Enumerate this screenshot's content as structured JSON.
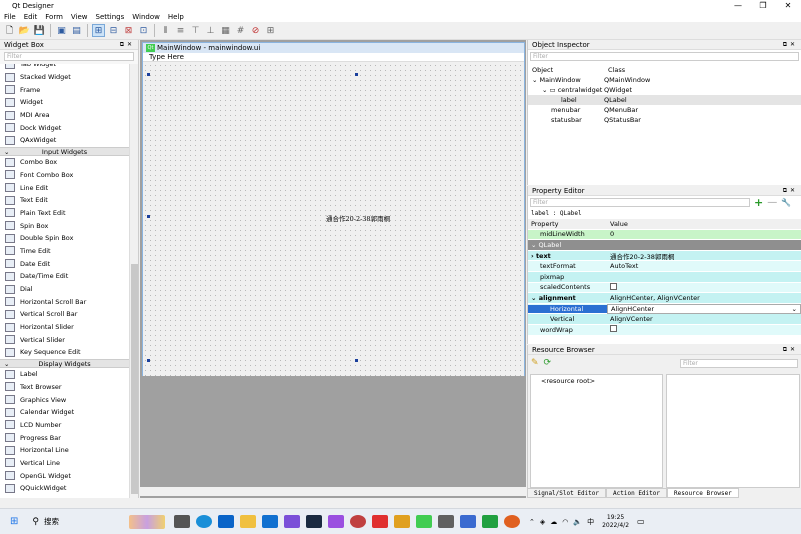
{
  "window": {
    "title": "Qt Designer",
    "minimize": "—",
    "maximize": "❐",
    "close": "✕"
  },
  "menu": [
    "File",
    "Edit",
    "Form",
    "View",
    "Settings",
    "Window",
    "Help"
  ],
  "widget_box": {
    "title": "Widget Box",
    "filter_placeholder": "Filter",
    "items_top": [
      {
        "label": "Tab Widget",
        "icon": "tab-widget-icon"
      },
      {
        "label": "Stacked Widget",
        "icon": "stacked-widget-icon"
      },
      {
        "label": "Frame",
        "icon": "frame-icon"
      },
      {
        "label": "Widget",
        "icon": "widget-icon"
      },
      {
        "label": "MDI Area",
        "icon": "mdi-area-icon"
      },
      {
        "label": "Dock Widget",
        "icon": "dock-widget-icon"
      },
      {
        "label": "QAxWidget",
        "icon": "qaxwidget-icon"
      }
    ],
    "category_input": "Input Widgets",
    "items_input": [
      {
        "label": "Combo Box",
        "icon": "combo-box-icon"
      },
      {
        "label": "Font Combo Box",
        "icon": "font-combo-box-icon"
      },
      {
        "label": "Line Edit",
        "icon": "line-edit-icon"
      },
      {
        "label": "Text Edit",
        "icon": "text-edit-icon"
      },
      {
        "label": "Plain Text Edit",
        "icon": "plain-text-edit-icon"
      },
      {
        "label": "Spin Box",
        "icon": "spin-box-icon"
      },
      {
        "label": "Double Spin Box",
        "icon": "double-spin-box-icon"
      },
      {
        "label": "Time Edit",
        "icon": "time-edit-icon"
      },
      {
        "label": "Date Edit",
        "icon": "date-edit-icon"
      },
      {
        "label": "Date/Time Edit",
        "icon": "datetime-edit-icon"
      },
      {
        "label": "Dial",
        "icon": "dial-icon"
      },
      {
        "label": "Horizontal Scroll Bar",
        "icon": "horizontal-scroll-bar-icon"
      },
      {
        "label": "Vertical Scroll Bar",
        "icon": "vertical-scroll-bar-icon"
      },
      {
        "label": "Horizontal Slider",
        "icon": "horizontal-slider-icon"
      },
      {
        "label": "Vertical Slider",
        "icon": "vertical-slider-icon"
      },
      {
        "label": "Key Sequence Edit",
        "icon": "key-sequence-edit-icon"
      }
    ],
    "category_display": "Display Widgets",
    "items_display": [
      {
        "label": "Label",
        "icon": "label-icon"
      },
      {
        "label": "Text Browser",
        "icon": "text-browser-icon"
      },
      {
        "label": "Graphics View",
        "icon": "graphics-view-icon"
      },
      {
        "label": "Calendar Widget",
        "icon": "calendar-widget-icon"
      },
      {
        "label": "LCD Number",
        "icon": "lcd-number-icon"
      },
      {
        "label": "Progress Bar",
        "icon": "progress-bar-icon"
      },
      {
        "label": "Horizontal Line",
        "icon": "horizontal-line-icon"
      },
      {
        "label": "Vertical Line",
        "icon": "vertical-line-icon"
      },
      {
        "label": "OpenGL Widget",
        "icon": "opengl-widget-icon"
      },
      {
        "label": "QQuickWidget",
        "icon": "qquickwidget-icon"
      }
    ]
  },
  "form": {
    "title": "MainWindow - mainwindow.ui",
    "menu_placeholder": "Type Here",
    "label_text": "通合作20-2-38郭雨桐"
  },
  "object_inspector": {
    "title": "Object Inspector",
    "filter_placeholder": "Filter",
    "col_object": "Object",
    "col_class": "Class",
    "rows": [
      {
        "object": "MainWindow",
        "class": "QMainWindow"
      },
      {
        "object": "centralwidget",
        "class": "QWidget"
      },
      {
        "object": "label",
        "class": "QLabel"
      },
      {
        "object": "menubar",
        "class": "QMenuBar"
      },
      {
        "object": "statusbar",
        "class": "QStatusBar"
      }
    ]
  },
  "property_editor": {
    "title": "Property Editor",
    "filter_placeholder": "Filter",
    "context": "label : QLabel",
    "col_property": "Property",
    "col_value": "Value",
    "midlinewidth": {
      "k": "midLineWidth",
      "v": "0"
    },
    "section": "QLabel",
    "text": {
      "k": "text",
      "v": "通合作20-2-38郭雨桐"
    },
    "textformat": {
      "k": "textFormat",
      "v": "AutoText"
    },
    "pixmap": {
      "k": "pixmap",
      "v": ""
    },
    "scaledcontents": {
      "k": "scaledContents",
      "v": ""
    },
    "alignment": {
      "k": "alignment",
      "v": "AlignHCenter, AlignVCenter"
    },
    "horizontal": {
      "k": "Horizontal",
      "v": "AlignHCenter"
    },
    "vertical": {
      "k": "Vertical",
      "v": "AlignVCenter"
    },
    "wordwrap": {
      "k": "wordWrap",
      "v": ""
    }
  },
  "resource_browser": {
    "title": "Resource Browser",
    "filter_placeholder": "Filter",
    "root": "<resource root>"
  },
  "bottom_tabs": [
    "Signal/Slot Editor",
    "Action Editor",
    "Resource Browser"
  ],
  "taskbar": {
    "search_label": "搜索",
    "ime": "中",
    "time": "19:25",
    "date": "2022/4/2"
  }
}
